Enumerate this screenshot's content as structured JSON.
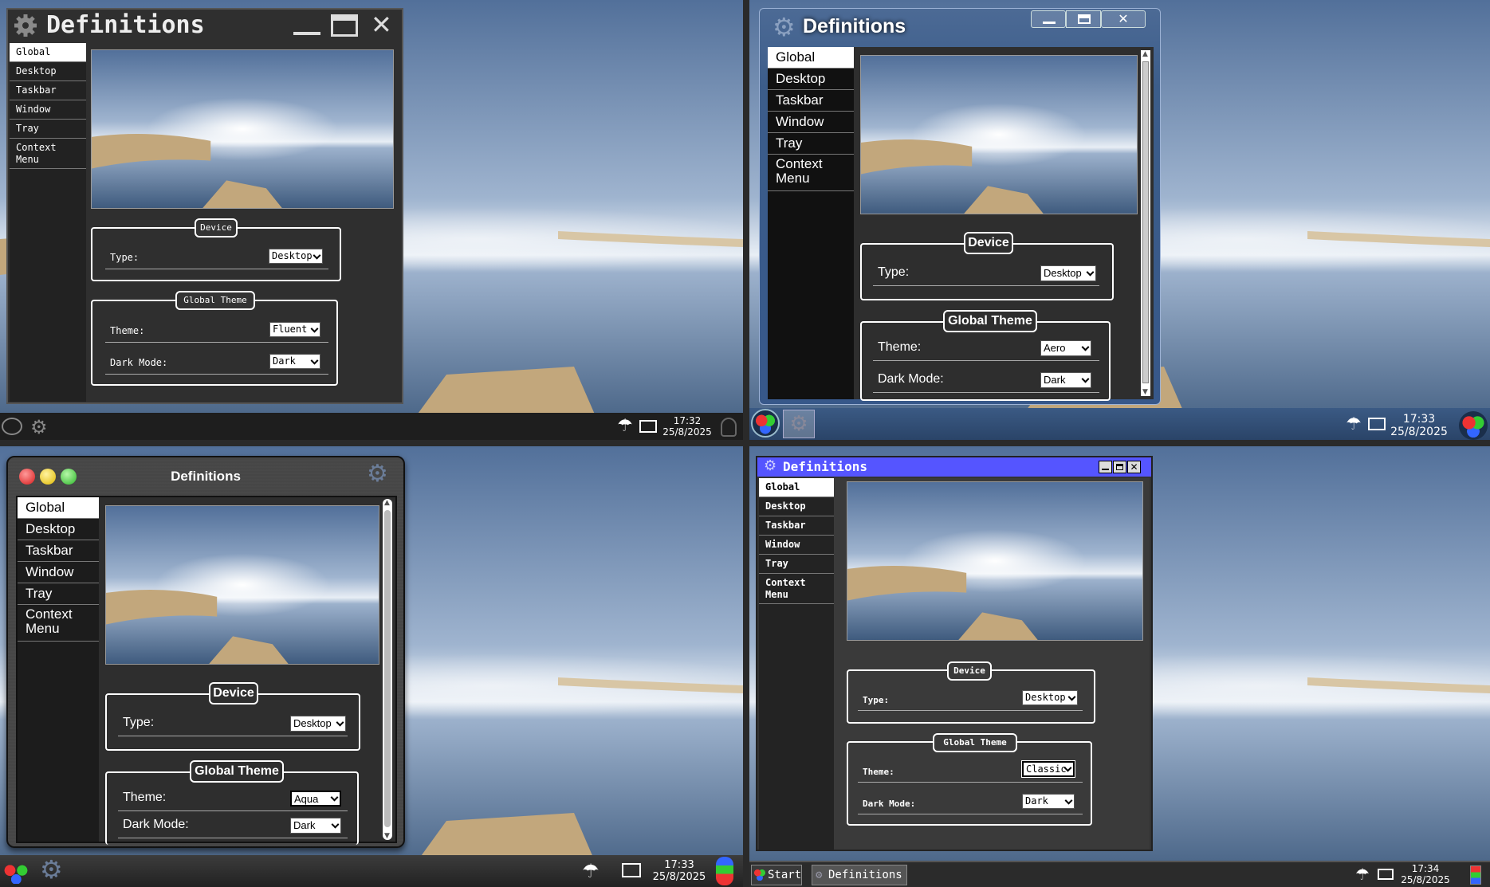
{
  "screens": [
    {
      "window_title": "Definitions",
      "sidebar": [
        "Global",
        "Desktop",
        "Taskbar",
        "Window",
        "Tray",
        "Context Menu"
      ],
      "device": {
        "legend": "Device",
        "type_label": "Type:",
        "type_value": "Desktop"
      },
      "theme": {
        "legend": "Global Theme",
        "theme_label": "Theme:",
        "theme_value": "Fluent",
        "dark_label": "Dark Mode:",
        "dark_value": "Dark"
      },
      "clock": {
        "time": "17:32",
        "date": "25/8/2025"
      }
    },
    {
      "window_title": "Definitions",
      "sidebar": [
        "Global",
        "Desktop",
        "Taskbar",
        "Window",
        "Tray",
        "Context Menu"
      ],
      "device": {
        "legend": "Device",
        "type_label": "Type:",
        "type_value": "Desktop"
      },
      "theme": {
        "legend": "Global Theme",
        "theme_label": "Theme:",
        "theme_value": "Aero",
        "dark_label": "Dark Mode:",
        "dark_value": "Dark"
      },
      "clock": {
        "time": "17:33",
        "date": "25/8/2025"
      }
    },
    {
      "window_title": "Definitions",
      "sidebar": [
        "Global",
        "Desktop",
        "Taskbar",
        "Window",
        "Tray",
        "Context Menu"
      ],
      "device": {
        "legend": "Device",
        "type_label": "Type:",
        "type_value": "Desktop"
      },
      "theme": {
        "legend": "Global Theme",
        "theme_label": "Theme:",
        "theme_value": "Aqua",
        "dark_label": "Dark Mode:",
        "dark_value": "Dark"
      },
      "clock": {
        "time": "17:33",
        "date": "25/8/2025"
      }
    },
    {
      "window_title": "Definitions",
      "sidebar": [
        "Global",
        "Desktop",
        "Taskbar",
        "Window",
        "Tray",
        "Context Menu"
      ],
      "device": {
        "legend": "Device",
        "type_label": "Type:",
        "type_value": "Desktop"
      },
      "theme": {
        "legend": "Global Theme",
        "theme_label": "Theme:",
        "theme_value": "Classic",
        "dark_label": "Dark Mode:",
        "dark_value": "Dark"
      },
      "clock": {
        "time": "17:34",
        "date": "25/8/2025"
      },
      "taskbar": {
        "start_label": "Start",
        "task_label": "Definitions"
      }
    }
  ],
  "colors": {
    "aero_accent": "#3c5d8a",
    "classic_titlebar": "#5555ff",
    "sky": "#8fa6c4",
    "sand": "#c2a77c",
    "sea": "#4a6485"
  },
  "icons": [
    "gear-icon",
    "minimize-icon",
    "maximize-icon",
    "close-icon",
    "umbrella-icon",
    "monitor-icon",
    "start-orb-icon",
    "user-icon",
    "scroll-up-icon",
    "scroll-down-icon"
  ]
}
